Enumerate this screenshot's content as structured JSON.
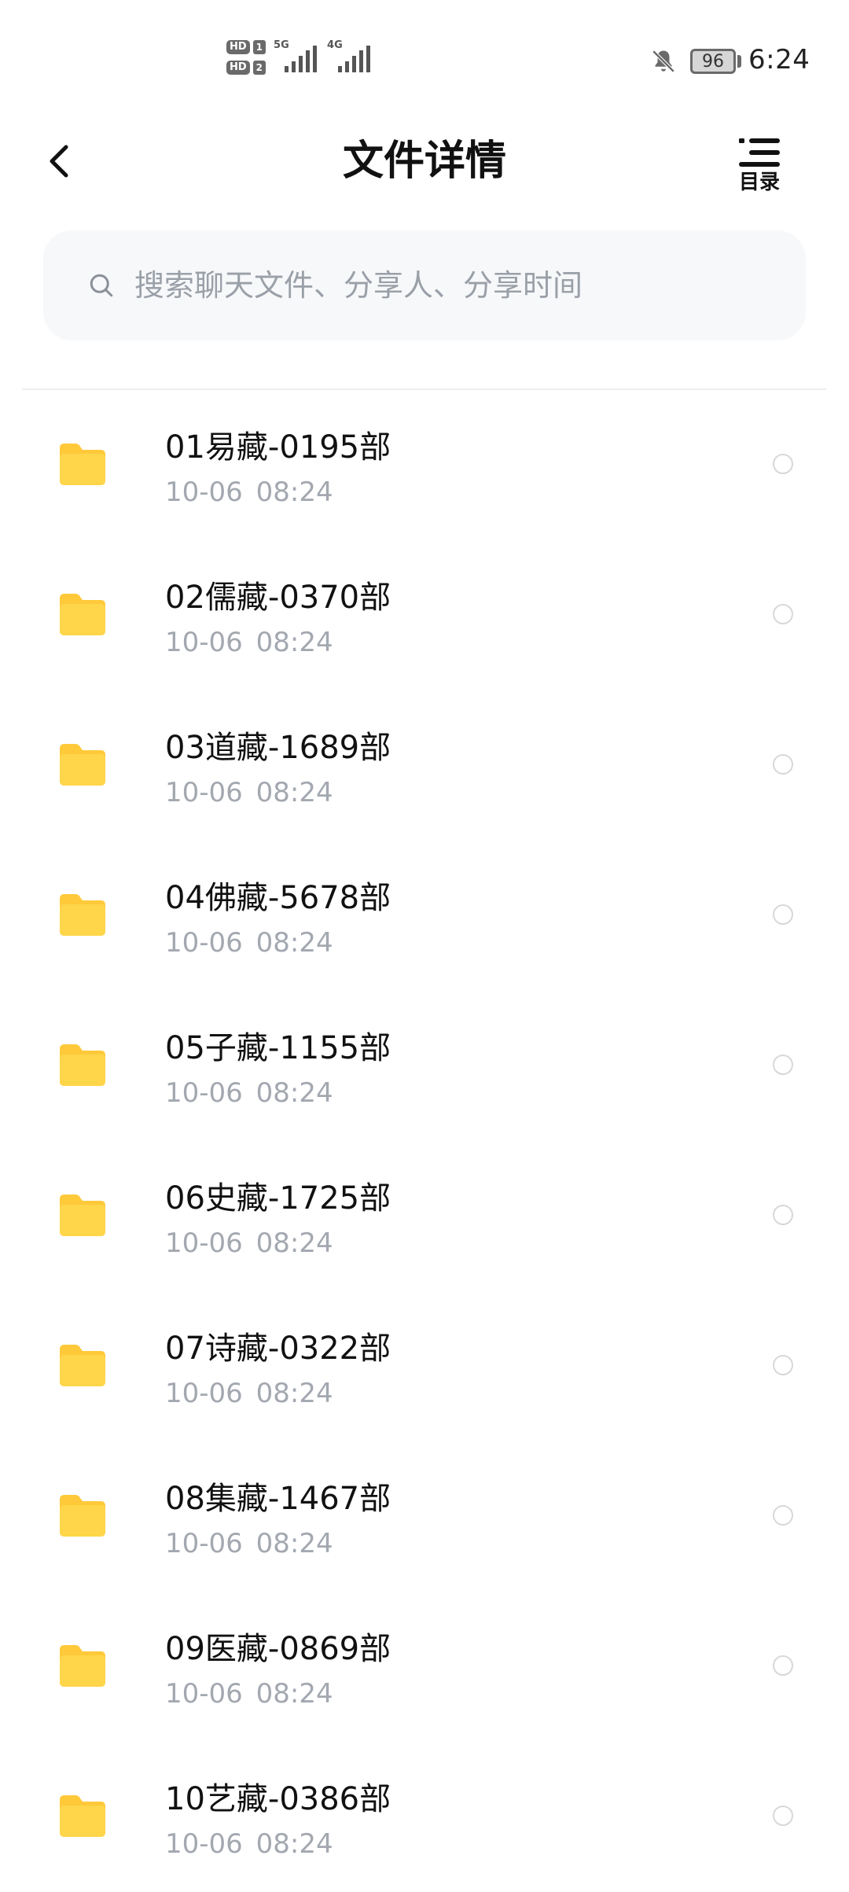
{
  "status_bar": {
    "hd1_label": "HD",
    "hd1_num": "1",
    "hd2_label": "HD",
    "hd2_num": "2",
    "signal1_label": "5G",
    "signal2_label": "4G",
    "battery_level": "96",
    "time": "6:24"
  },
  "header": {
    "title": "文件详情",
    "toc_label": "目录"
  },
  "search": {
    "placeholder": "搜索聊天文件、分享人、分享时间",
    "value": ""
  },
  "files": [
    {
      "name": "01易藏-0195部",
      "time": "10-06 08:24"
    },
    {
      "name": "02儒藏-0370部",
      "time": "10-06 08:24"
    },
    {
      "name": "03道藏-1689部",
      "time": "10-06 08:24"
    },
    {
      "name": "04佛藏-5678部",
      "time": "10-06 08:24"
    },
    {
      "name": "05子藏-1155部",
      "time": "10-06 08:24"
    },
    {
      "name": "06史藏-1725部",
      "time": "10-06 08:24"
    },
    {
      "name": "07诗藏-0322部",
      "time": "10-06 08:24"
    },
    {
      "name": "08集藏-1467部",
      "time": "10-06 08:24"
    },
    {
      "name": "09医藏-0869部",
      "time": "10-06 08:24"
    },
    {
      "name": "10艺藏-0386部",
      "time": "10-06 08:24"
    }
  ],
  "colors": {
    "folder": "#ffd54a",
    "folder_tab": "#ffc93a",
    "subtext": "#a3a8b0",
    "search_bg": "#f7f8fa"
  },
  "icons": {
    "back": "chevron-left-icon",
    "toc": "list-icon",
    "search": "search-icon",
    "folder": "folder-icon",
    "bell": "bell-muted-icon"
  }
}
